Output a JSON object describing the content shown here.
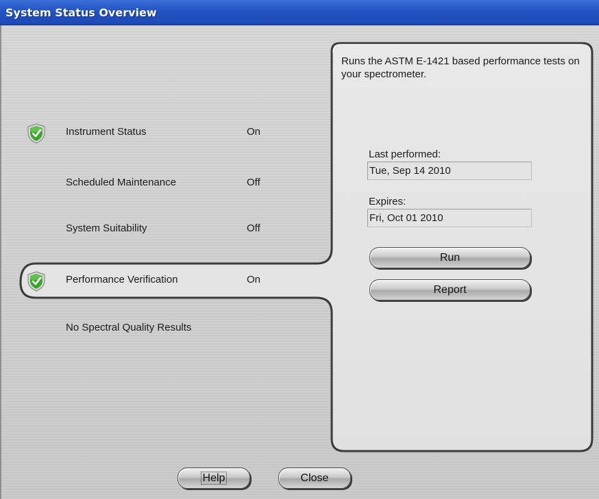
{
  "window": {
    "title": "System Status Overview"
  },
  "status_items": [
    {
      "label": "Instrument Status",
      "value": "On",
      "icon": "green-check-shield-icon"
    },
    {
      "label": "Scheduled Maintenance",
      "value": "Off"
    },
    {
      "label": "System Suitability",
      "value": "Off"
    },
    {
      "label": "Performance Verification",
      "value": "On",
      "icon": "green-check-shield-icon",
      "selected": true
    }
  ],
  "no_results_text": "No Spectral Quality Results",
  "detail": {
    "description": "Runs the ASTM E-1421 based performance tests on your spectrometer.",
    "last_performed_label": "Last performed:",
    "last_performed_value": "Tue, Sep 14 2010",
    "expires_label": "Expires:",
    "expires_value": "Fri, Oct 01 2010",
    "run_label": "Run",
    "report_label": "Report"
  },
  "footer": {
    "help_label": "Help",
    "close_label": "Close"
  },
  "colors": {
    "titlebar": "#2253c4",
    "panel": "#e4e4e4",
    "shield": "#3a9a2a"
  }
}
